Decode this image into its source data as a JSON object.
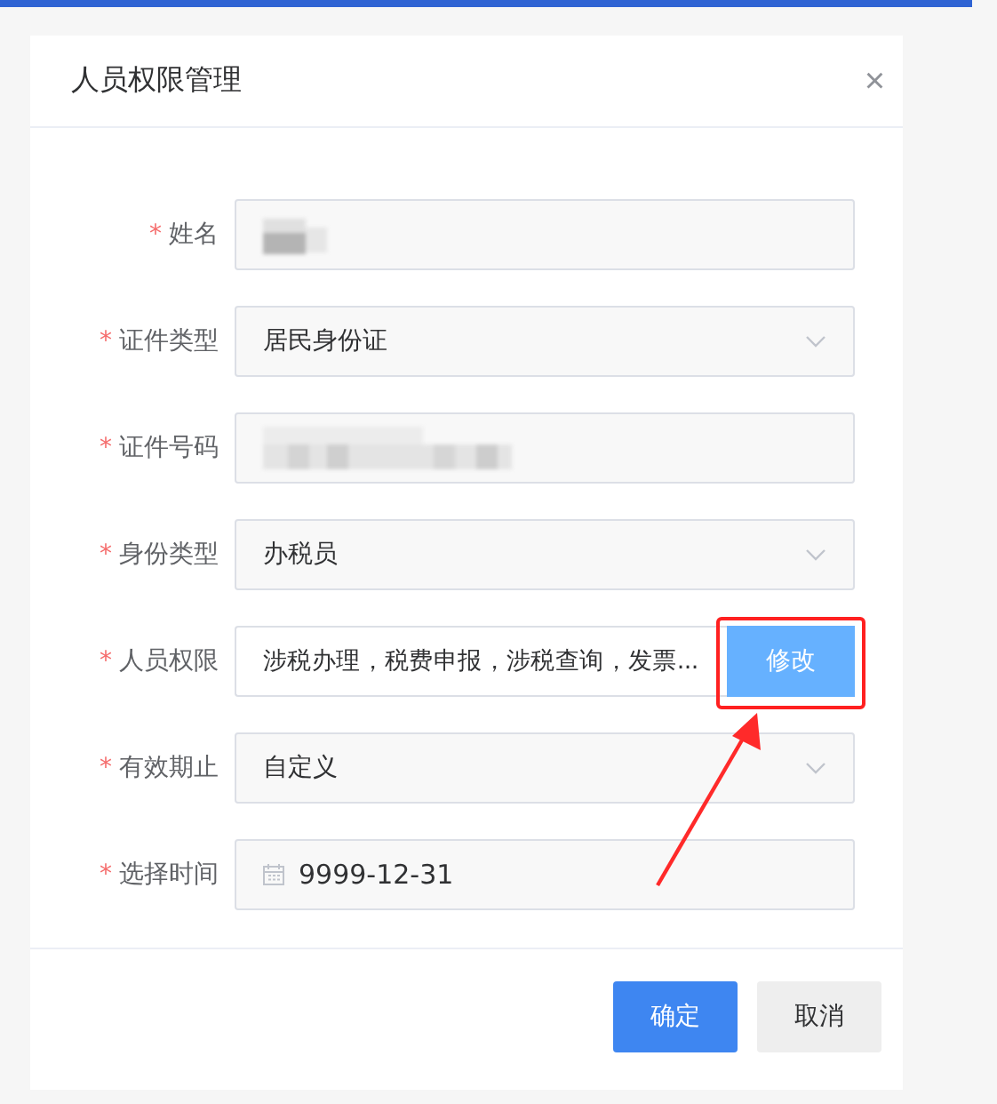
{
  "dialog": {
    "title": "人员权限管理",
    "close": "×"
  },
  "fields": [
    {
      "kind": "redacted",
      "label": "姓名",
      "required_mark": "*"
    },
    {
      "kind": "select",
      "label": "证件类型",
      "required_mark": "*",
      "value": "居民身份证"
    },
    {
      "kind": "redactedlong",
      "label": "证件号码",
      "required_mark": "*"
    },
    {
      "kind": "select",
      "label": "身份类型",
      "required_mark": "*",
      "value": "办税员"
    },
    {
      "kind": "permission",
      "label": "人员权限",
      "required_mark": "*",
      "value": "涉税办理，税费申报，涉税查询，发票...",
      "button": "修改"
    },
    {
      "kind": "select",
      "label": "有效期止",
      "required_mark": "*",
      "value": "自定义"
    },
    {
      "kind": "date",
      "label": "选择时间",
      "required_mark": "*",
      "value": "9999-12-31"
    }
  ],
  "footer": {
    "buttons": [
      {
        "label": "确定",
        "kind": "primary"
      },
      {
        "label": "取消",
        "kind": "default"
      }
    ]
  }
}
